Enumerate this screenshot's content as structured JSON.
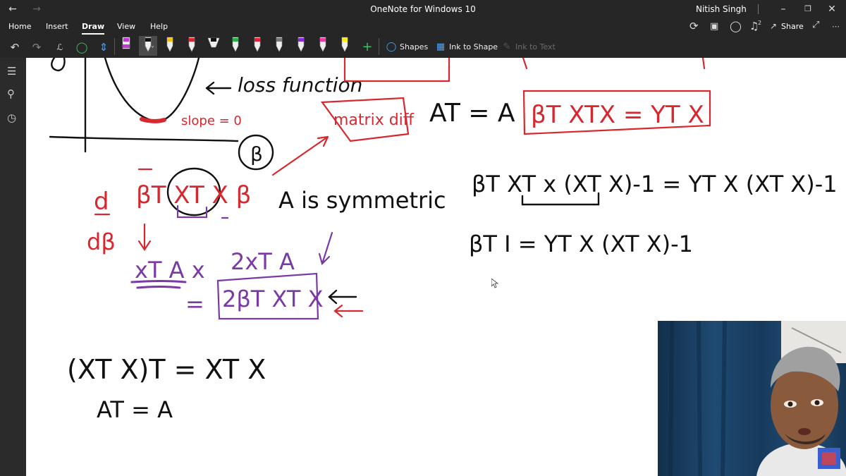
{
  "window": {
    "title": "OneNote for Windows 10",
    "user": "Nitish Singh"
  },
  "menu": {
    "items": [
      "Home",
      "Insert",
      "Draw",
      "View",
      "Help"
    ],
    "active": "Draw",
    "share_label": "Share",
    "notification_count": "2"
  },
  "toolbar": {
    "shapes_label": "Shapes",
    "ink_to_shape_label": "Ink to Shape",
    "ink_to_text_label": "Ink to Text",
    "pens": [
      {
        "color": "#c03ad1",
        "kind": "marker"
      },
      {
        "color": "#111111",
        "kind": "pen",
        "selected": true
      },
      {
        "color": "#f2c21b",
        "kind": "pen"
      },
      {
        "color": "#e0232f",
        "kind": "pen"
      },
      {
        "color": "#111111",
        "kind": "highlighter"
      },
      {
        "color": "#25b04a",
        "kind": "pen"
      },
      {
        "color": "#e0233a",
        "kind": "pen"
      },
      {
        "color": "#7a7a7a",
        "kind": "pen"
      },
      {
        "color": "#8a2ad6",
        "kind": "pen"
      },
      {
        "color": "#f23aa5",
        "kind": "pen"
      },
      {
        "color": "#f5ec1c",
        "kind": "pen"
      }
    ]
  },
  "ink_colors": {
    "black": "#111111",
    "red": "#d7282f",
    "purple": "#7a3aa6",
    "chrome": "#262626"
  },
  "notes": {
    "loss_function": "loss function",
    "slope": "slope = 0",
    "beta_axis": "β",
    "matrix_box": "matrix diff",
    "at_eq_a": "AT = A",
    "boxed_eq": "βT XTX = YT X",
    "derivative_top": "d",
    "derivative_bottom": "dβ",
    "bt_xtx_b": "βT XT X β",
    "a_symmetric": "A is symmetric",
    "xtax": "xT A x",
    "two_xta": "2xT A",
    "equals": "=",
    "two_bt_xtx": "2βT XT X",
    "eq_line1": "βT XT x (XT X)-1 = YT X (XT X)-1",
    "eq_line2": "βT I = YT X (XT X)-1",
    "transpose_eq": "(XT X)T = XT X",
    "at_a_bottom": "AT = A"
  }
}
